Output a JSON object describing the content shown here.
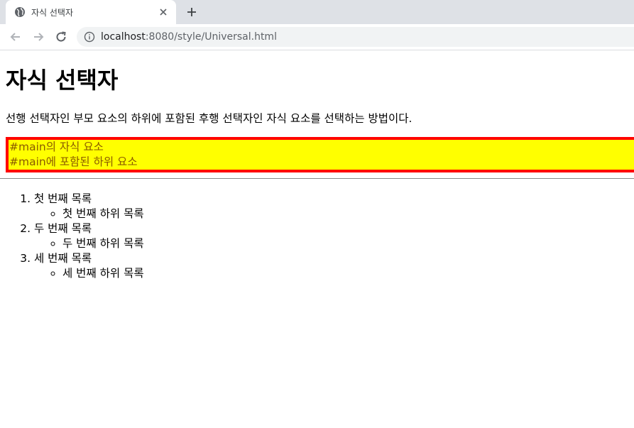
{
  "browser": {
    "tab_title": "자식 선택자",
    "url_host": "localhost",
    "url_rest": ":8080/style/Universal.html"
  },
  "page": {
    "heading": "자식 선택자",
    "intro": "선행 선택자인 부모 요소의 하위에 포함된 후행 선택자인 자식 요소를 선택하는 방법이다.",
    "box_lines": [
      "#main의 자식 요소",
      "#main에 포함된 하위 요소"
    ],
    "list": [
      {
        "label": "첫 번째 목록",
        "sub": "첫 번째 하위 목록"
      },
      {
        "label": "두 번째 목록",
        "sub": "두 번째 하위 목록"
      },
      {
        "label": "세 번째 목록",
        "sub": "세 번째 하위 목록"
      }
    ]
  },
  "colors": {
    "box_border": "#ff0000",
    "box_background": "#ffff00",
    "box_text": "#8a5a00"
  }
}
